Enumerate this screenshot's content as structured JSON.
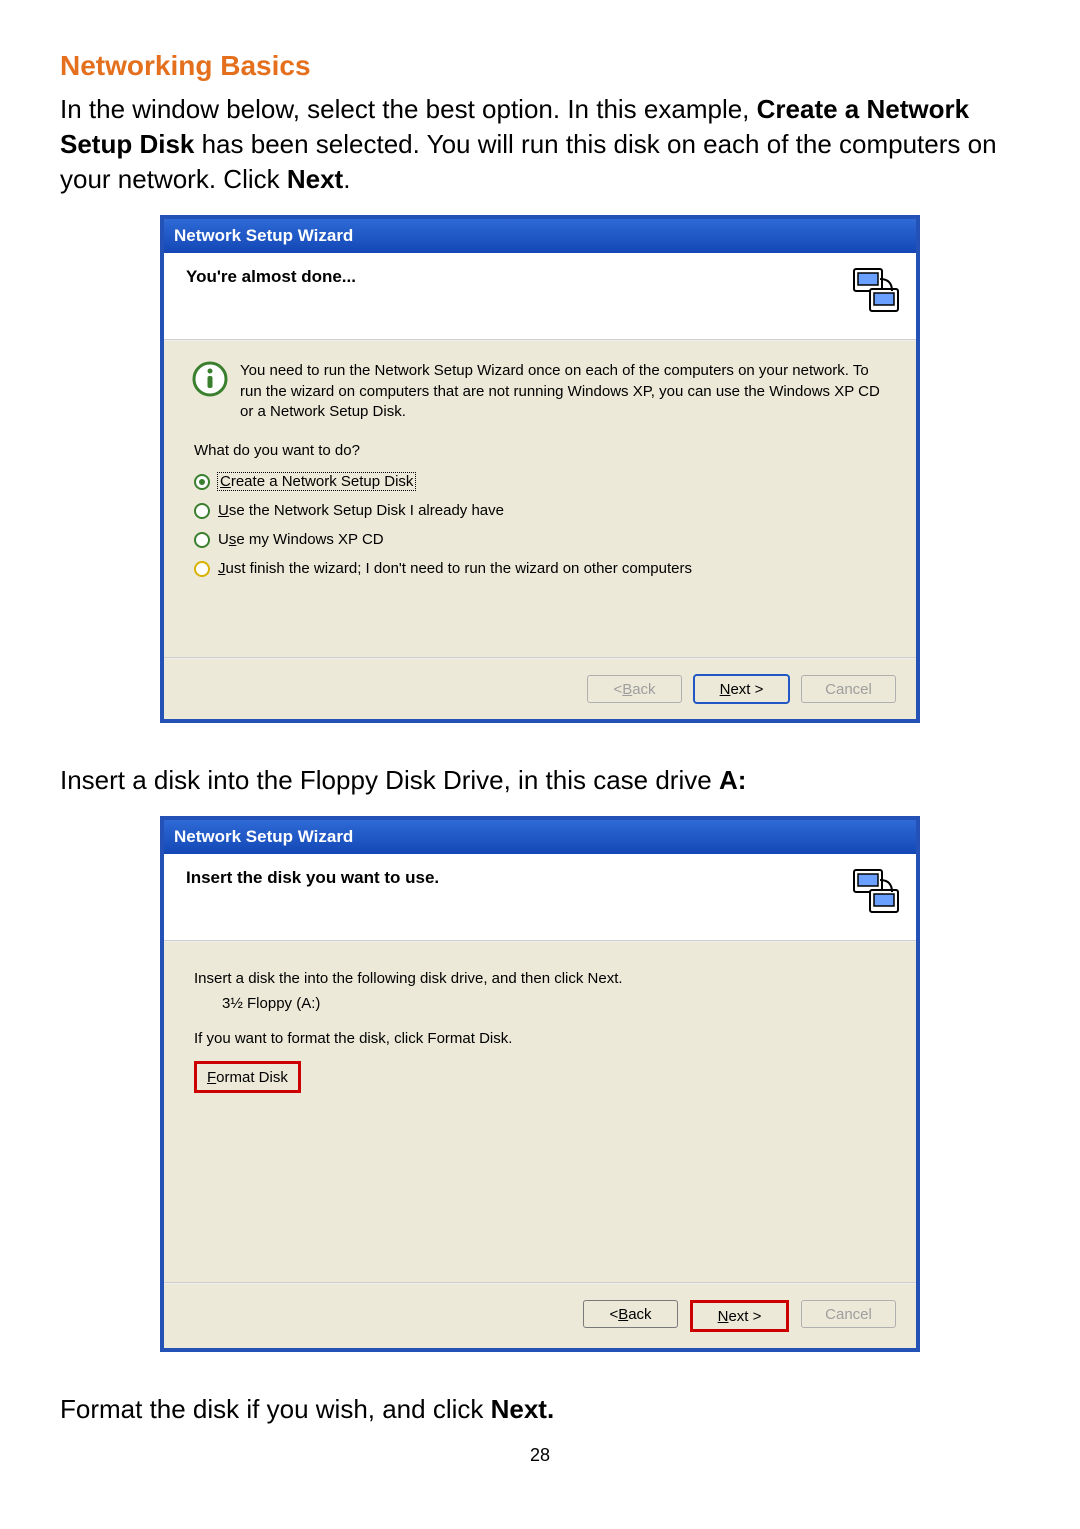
{
  "doc": {
    "section_title": "Networking Basics",
    "para1_before": "In the window below, select the best option.  In this example, ",
    "para1_bold": "Create a Network Setup Disk",
    "para1_mid": " has been selected.  You will run this disk on each of the computers on your network.  Click ",
    "para1_next": "Next",
    "para1_end": ".",
    "para2_before": "Insert a disk into the Floppy Disk Drive, in this case drive ",
    "para2_bold": "A:",
    "para3_before": "Format the disk if you wish, and click ",
    "para3_bold": "Next.",
    "page_number": "28"
  },
  "wizard1": {
    "title": "Network Setup Wizard",
    "header": "You're almost done...",
    "info": "You need to run the Network Setup Wizard once on each of the computers on your network. To run the wizard on computers that are not running Windows XP, you can use the Windows XP CD or a Network Setup Disk.",
    "question": "What do you want to do?",
    "options": [
      {
        "prefix": "C",
        "rest": "reate a Network Setup Disk",
        "selected": true,
        "yellow": false,
        "focused": true
      },
      {
        "prefix": "U",
        "rest": "se the Network Setup Disk I already have",
        "selected": false,
        "yellow": false,
        "focused": false
      },
      {
        "prefix": "",
        "rest": "Use my Windows XP CD",
        "selected": false,
        "yellow": false,
        "focused": false,
        "ul_index": 2,
        "label_raw": "Use my Windows XP CD"
      },
      {
        "prefix": "J",
        "rest": "ust finish the wizard; I don't need to run the wizard on other computers",
        "selected": false,
        "yellow": true,
        "focused": false
      }
    ],
    "back": "Back",
    "next": "Next >",
    "cancel": "Cancel"
  },
  "wizard2": {
    "title": "Network Setup Wizard",
    "header": "Insert the disk you want to use.",
    "line1": "Insert a disk the into the following disk drive, and then click Next.",
    "drive": "3½ Floppy (A:)",
    "line2": "If you want to format the disk, click Format Disk.",
    "format": "Format Disk",
    "format_prefix": "F",
    "format_rest": "ormat Disk",
    "back": "Back",
    "next": "Next >",
    "cancel": "Cancel"
  }
}
